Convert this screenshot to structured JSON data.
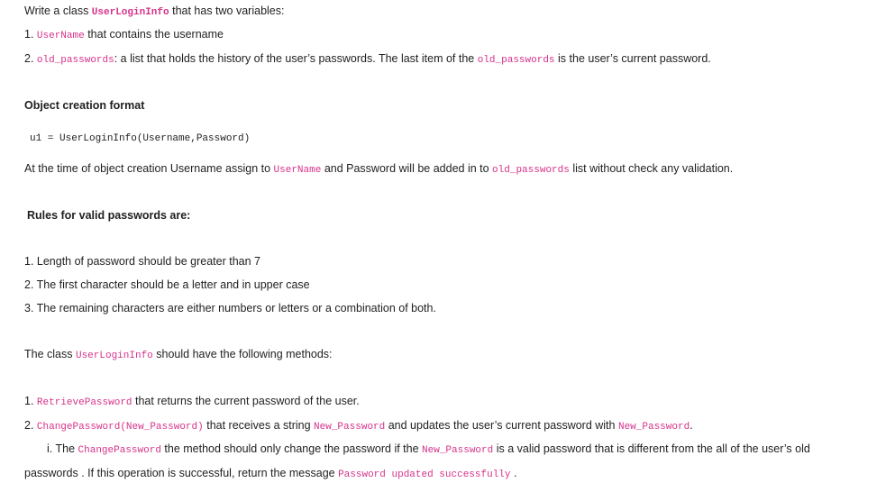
{
  "intro": {
    "before": "Write a class ",
    "class_name": "UserLoginInfo",
    "after": " that has two variables:"
  },
  "variables": [
    {
      "num": "1. ",
      "code": "UserName",
      "text": " that contains the username"
    },
    {
      "num": "2. ",
      "code": "old_passwords",
      "text": ": a list that holds the history of the user’s passwords. The last item of the ",
      "code2": "old_passwords",
      "text2": " is the user’s current password."
    }
  ],
  "object_format": {
    "heading": "Object creation format",
    "code": "u1 = UserLoginInfo(Username,Password)"
  },
  "creation_note": {
    "before": "At the time of object creation Username assign to ",
    "code1": "UserName",
    "middle": " and Password will be added in to ",
    "code2": "old_passwords",
    "after": " list without check any validation."
  },
  "rules": {
    "heading": "Rules for valid passwords are:",
    "items": [
      "1. Length of password should be greater than 7",
      "2. The first character should be a letter and in upper case",
      "3. The remaining characters are either numbers or letters or a combination of both."
    ]
  },
  "methods_intro": {
    "before": "The class ",
    "code": "UserLoginInfo",
    "after": " should have the following methods:"
  },
  "methods": {
    "m1": {
      "num": "1. ",
      "code": "RetrievePassword",
      "text": " that returns the current password of the user."
    },
    "m2": {
      "num": "2. ",
      "code": "ChangePassword(New_Password)",
      "text1": " that receives a string ",
      "code2": "New_Password",
      "text2": " and updates the user’s current password with ",
      "code3": "New_Password",
      "text3": "."
    },
    "m2_sub": {
      "prefix": "i. The ",
      "code1": "ChangePassword",
      "text1": " the method should only change the password if the ",
      "code2": "New_Password",
      "text2": " is a valid password that is different from the all of the user’s old",
      "cont": "passwords . If this operation is successful, return the message ",
      "code3": "Password updated successfully",
      "text3": " ."
    }
  }
}
